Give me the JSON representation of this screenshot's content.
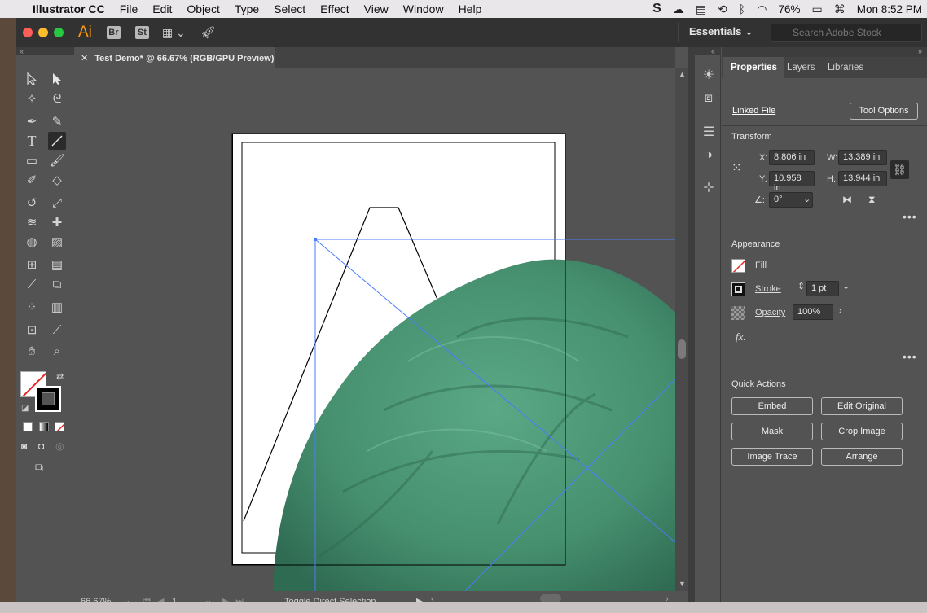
{
  "menubar": {
    "app": "Illustrator CC",
    "items": [
      "File",
      "Edit",
      "Object",
      "Type",
      "Select",
      "Effect",
      "View",
      "Window",
      "Help"
    ],
    "battery": "76%",
    "clock": "Mon 8:52 PM"
  },
  "appbar": {
    "logo": "Ai",
    "bridge": "Br",
    "stock_app": "St",
    "workspace": "Essentials",
    "search_placeholder": "Search Adobe Stock"
  },
  "document": {
    "tab_title": "Test Demo* @ 66.67% (RGB/GPU Preview)"
  },
  "status": {
    "zoom": "66.67%",
    "artboard": "1",
    "tool_hint": "Toggle Direct Selection"
  },
  "properties": {
    "tabs": [
      "Properties",
      "Layers",
      "Libraries"
    ],
    "linked_file": "Linked File",
    "tool_options": "Tool Options",
    "transform_title": "Transform",
    "x_label": "X:",
    "x_value": "8.806 in",
    "y_label": "Y:",
    "y_value": "10.958 in",
    "w_label": "W:",
    "w_value": "13.389 in",
    "h_label": "H:",
    "h_value": "13.944 in",
    "angle_value": "0°",
    "appearance_title": "Appearance",
    "fill_label": "Fill",
    "stroke_label": "Stroke",
    "stroke_value": "1 pt",
    "opacity_label": "Opacity",
    "opacity_value": "100%",
    "fx_label": "fx.",
    "quick_actions_title": "Quick Actions",
    "actions": [
      "Embed",
      "Edit Original",
      "Mask",
      "Crop Image",
      "Image Trace",
      "Arrange"
    ]
  },
  "colors": {
    "beanbag": "#4a9473",
    "selection": "#4a7bff",
    "ui_dark": "#323232",
    "ui_panel": "#535353"
  }
}
